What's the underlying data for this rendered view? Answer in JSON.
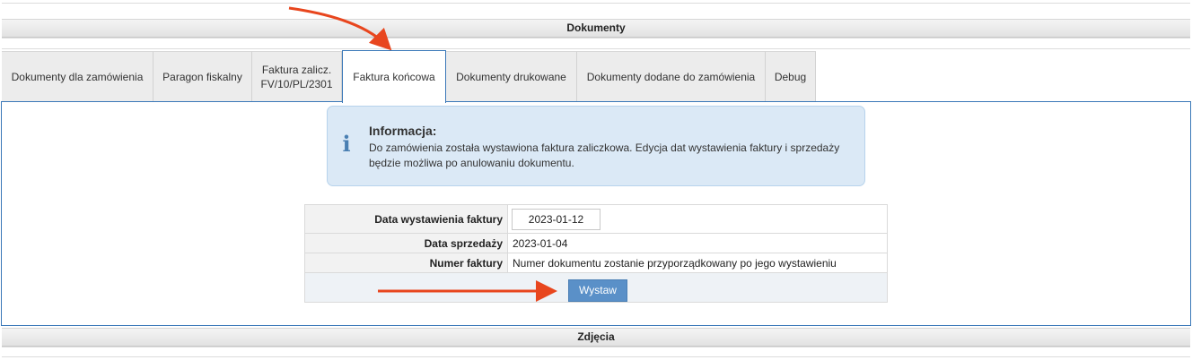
{
  "sections": {
    "documents_title": "Dokumenty",
    "photos_title": "Zdjęcia"
  },
  "tabs": [
    {
      "label": "Dokumenty dla zamówienia"
    },
    {
      "label": "Paragon fiskalny"
    },
    {
      "label_line1": "Faktura zalicz.",
      "label_line2": "FV/10/PL/2301"
    },
    {
      "label": "Faktura końcowa",
      "active": true
    },
    {
      "label": "Dokumenty drukowane"
    },
    {
      "label": "Dokumenty dodane do zamówienia"
    },
    {
      "label": "Debug"
    }
  ],
  "info": {
    "icon": "info-icon",
    "title": "Informacja:",
    "text": "Do zamówienia została wystawiona faktura zaliczkowa. Edycja dat wystawienia faktury i sprzedaży będzie możliwa po anulowaniu dokumentu."
  },
  "form": {
    "issue_date_label": "Data wystawienia faktury",
    "issue_date_value": "2023-01-12",
    "sale_date_label": "Data sprzedaży",
    "sale_date_value": "2023-01-04",
    "invoice_number_label": "Numer faktury",
    "invoice_number_value": "Numer dokumentu zostanie przyporządkowany po jego wystawieniu",
    "submit_label": "Wystaw"
  },
  "colors": {
    "accent": "#3a78b8",
    "button": "#5a90c8",
    "info_bg": "#dbe9f6",
    "annotation_arrow": "#e8461e"
  }
}
